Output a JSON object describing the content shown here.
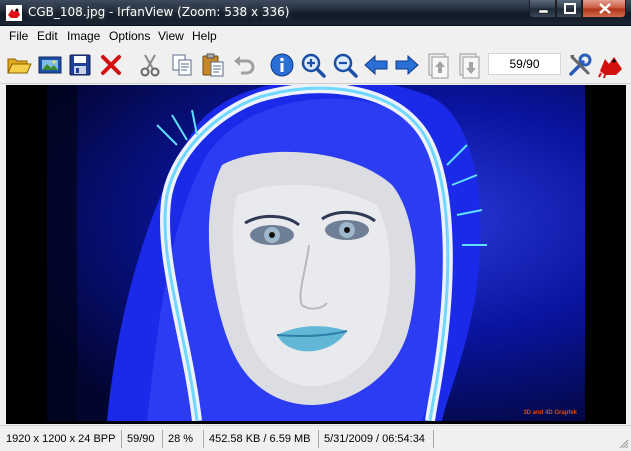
{
  "window": {
    "title": "CGB_108.jpg - IrfanView (Zoom: 538 x 336)",
    "accent": "#1b2634",
    "close_color": "#c6543b"
  },
  "menu": {
    "items": [
      "File",
      "Edit",
      "Image",
      "Options",
      "View",
      "Help"
    ]
  },
  "toolbar": {
    "buttons": [
      {
        "icon": "open-folder-icon"
      },
      {
        "icon": "slideshow-icon"
      },
      {
        "icon": "save-icon"
      },
      {
        "icon": "delete-icon"
      },
      {
        "icon": "cut-icon"
      },
      {
        "icon": "copy-icon"
      },
      {
        "icon": "paste-icon"
      },
      {
        "icon": "undo-icon"
      },
      {
        "icon": "info-icon"
      },
      {
        "icon": "zoom-in-icon"
      },
      {
        "icon": "zoom-out-icon"
      },
      {
        "icon": "previous-arrow-icon"
      },
      {
        "icon": "next-arrow-icon"
      },
      {
        "icon": "first-image-icon"
      },
      {
        "icon": "last-image-icon"
      },
      {
        "icon": "settings-tools-icon"
      },
      {
        "icon": "irfanview-cat-icon"
      }
    ],
    "counter": "59/90"
  },
  "image": {
    "watermark": "3D and 4D Graphik",
    "bg_color": "#1020b8"
  },
  "status": {
    "dimensions": "1920 x 1200 x 24 BPP",
    "index": "59/90",
    "zoom": "28 %",
    "size": "452.58 KB / 6.59 MB",
    "datetime": "5/31/2009 / 06:54:34"
  }
}
